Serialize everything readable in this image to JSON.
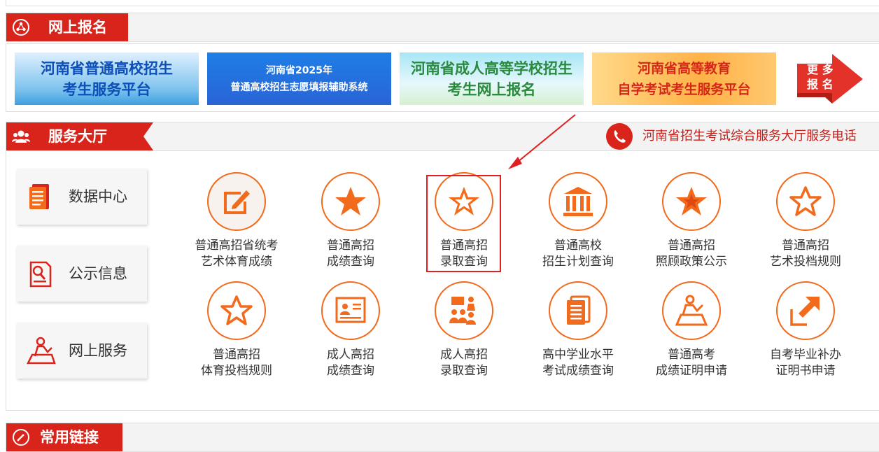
{
  "sections": {
    "online_signup": {
      "title": "网上报名"
    },
    "service_hall": {
      "title": "服务大厅",
      "phone_label": "河南省招生考试综合服务大厅服务电话"
    },
    "common_links": {
      "title": "常用链接"
    }
  },
  "banners": [
    {
      "line1": "河南省普通高校招生",
      "line2": "考生服务平台"
    },
    {
      "line1": "河南省2025年",
      "line2": "普通高校招生志愿填报辅助系统"
    },
    {
      "line1": "河南省成人高等学校招生",
      "line2": "考生网上报名"
    },
    {
      "line1": "河南省高等教育",
      "line2": "自学考试考生服务平台"
    }
  ],
  "more_signup": {
    "line1": "更 多",
    "line2": "报 名"
  },
  "sidebar": [
    {
      "label": "数据中心",
      "icon": "document-icon"
    },
    {
      "label": "公示信息",
      "icon": "notice-icon"
    },
    {
      "label": "网上服务",
      "icon": "online-service-icon"
    }
  ],
  "services": [
    {
      "line1": "普通高招省统考",
      "line2": "艺术体育成绩",
      "icon": "edit-icon"
    },
    {
      "line1": "普通高招",
      "line2": "成绩查询",
      "icon": "star-filled-icon"
    },
    {
      "line1": "普通高招",
      "line2": "录取查询",
      "icon": "star-outline-icon"
    },
    {
      "line1": "普通高校",
      "line2": "招生计划查询",
      "icon": "building-icon"
    },
    {
      "line1": "普通高招",
      "line2": "照顾政策公示",
      "icon": "star-filled-icon"
    },
    {
      "line1": "普通高招",
      "line2": "艺术投档规则",
      "icon": "star-outline-icon"
    },
    {
      "line1": "普通高招",
      "line2": "体育投档规则",
      "icon": "star-outline-icon"
    },
    {
      "line1": "成人高招",
      "line2": "成绩查询",
      "icon": "certificate-icon"
    },
    {
      "line1": "成人高招",
      "line2": "录取查询",
      "icon": "classroom-icon"
    },
    {
      "line1": "高中学业水平",
      "line2": "考试成绩查询",
      "icon": "document-icon"
    },
    {
      "line1": "普通高考",
      "line2": "成绩证明申请",
      "icon": "person-desk-icon"
    },
    {
      "line1": "自考毕业补办",
      "line2": "证明书申请",
      "icon": "arrow-diagonal-icon"
    }
  ],
  "colors": {
    "brand_red": "#d9241c",
    "accent_orange": "#f26a1b",
    "highlight_red": "#e02020"
  }
}
